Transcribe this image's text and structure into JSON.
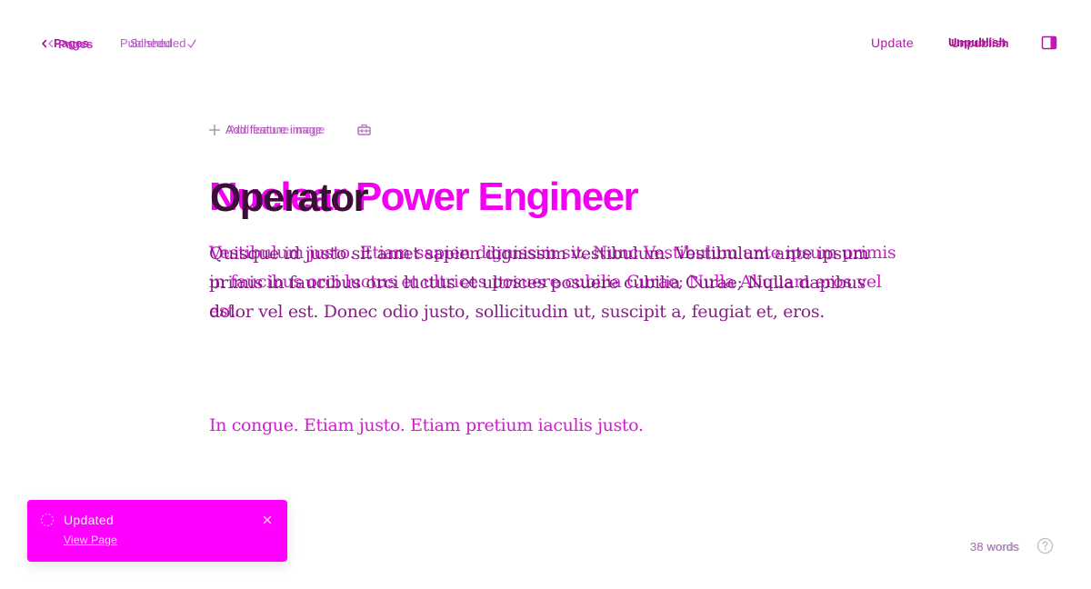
{
  "header": {
    "back_label": "Pages",
    "back_label_shadow": "Pages",
    "status": "Published",
    "status_shadow": "Scheduled",
    "update_label": "Update",
    "unpublish_label": "Unpublish",
    "unpublish_label_shadow": "Unpublish"
  },
  "editor": {
    "add_feature_image": "Add feature image",
    "add_feature_image_shadow": "Add feature image",
    "title": "Nuclear Power Engineer",
    "title_shadow": "Operator",
    "body_a": "Vestibulum justo. Etiam sapien dignissim sit. Nunc Vestibulum ante ipsum primis in faucibus orci luctus et ultrices posuere cubilia Curae; Nulla Aliquam eros vel est.",
    "body_b": "Quisque id justo sit amet sapien dignissim vestibulum. Vestibulum ante ipsum primis in faucibus orci luctus et ultrices posuere cubilia Curae; Nulla dapibus dolor vel est. Donec odio justo, sollicitudin ut, suscipit a, feugiat et, eros.",
    "paragraph_2": "In congue. Etiam justo. Etiam pretium iaculis justo."
  },
  "toast": {
    "title": "Updated",
    "link_label": "View Page"
  },
  "footer": {
    "word_count": "38 words",
    "word_count_shadow": "36 words"
  },
  "colors": {
    "accent": "#ff00ff",
    "title": "#f200f2",
    "text_dark": "#3b0e36"
  },
  "icons": {
    "back": "chevron-left-icon",
    "published": "check-icon",
    "add": "plus-icon",
    "snippet": "snippet-icon",
    "sidebar": "sidebar-toggle-icon",
    "toast_spinner": "spinner-icon",
    "toast_close": "close-icon",
    "help": "help-icon"
  }
}
